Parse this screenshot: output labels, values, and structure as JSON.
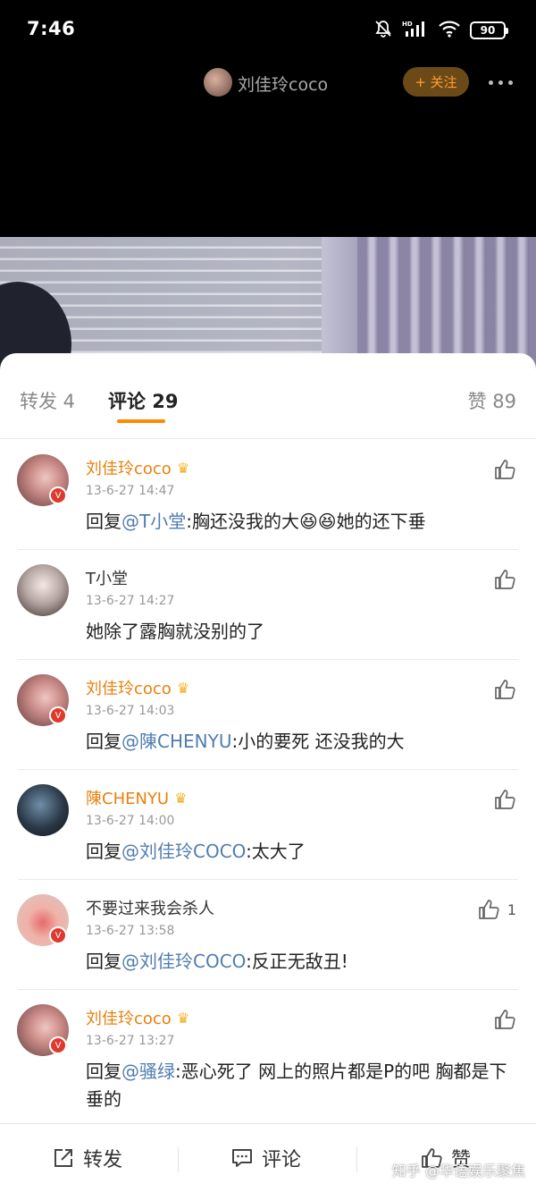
{
  "status_bar": {
    "time": "7:46",
    "battery": "90",
    "icons": [
      "bell-off-icon",
      "hd-signal-icon",
      "wifi-icon",
      "battery-icon"
    ]
  },
  "header": {
    "author": "刘佳玲coco",
    "follow_label": "+ 关注",
    "more_icon": "more-icon"
  },
  "tabs": {
    "repost": "转发 4",
    "comments": "评论 29",
    "likes": "赞 89"
  },
  "comments": [
    {
      "name": "刘佳玲coco",
      "time": "13-6-27 14:47",
      "prefix": "回复",
      "mention": "@T小堂",
      "text": ":胸还没我的大😆😆她的还下垂",
      "likes": ""
    },
    {
      "name": "T小堂",
      "time": "13-6-27 14:27",
      "prefix": "",
      "mention": "",
      "text": "她除了露胸就没别的了",
      "likes": ""
    },
    {
      "name": "刘佳玲coco",
      "time": "13-6-27 14:03",
      "prefix": "回复",
      "mention": "@陳CHENYU",
      "text": ":小的要死 还没我的大",
      "likes": ""
    },
    {
      "name": "陳CHENYU",
      "time": "13-6-27 14:00",
      "prefix": "回复",
      "mention": "@刘佳玲COCO",
      "text": ":太大了",
      "likes": ""
    },
    {
      "name": "不要过来我会杀人",
      "time": "13-6-27 13:58",
      "prefix": "回复",
      "mention": "@刘佳玲COCO",
      "text": ":反正无敌丑!",
      "likes": "1"
    },
    {
      "name": "刘佳玲coco",
      "time": "13-6-27 13:27",
      "prefix": "回复",
      "mention": "@骚绿",
      "text": ":恶心死了 网上的照片都是P的吧 胸都是下垂的",
      "likes": ""
    }
  ],
  "bottom_bar": {
    "repost": "转发",
    "comment": "评论",
    "like": "赞"
  },
  "watermark": "知乎 @华语娱乐聚焦",
  "colors": {
    "accent": "#ff8a00",
    "vip_name": "#e8800d",
    "mention": "#507daf",
    "follow_text": "#ff9f30"
  }
}
